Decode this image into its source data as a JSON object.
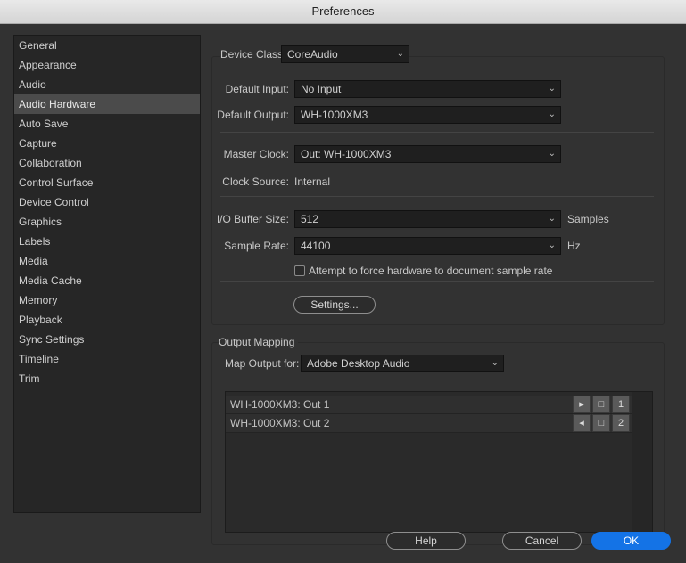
{
  "window": {
    "title": "Preferences"
  },
  "sidebar": {
    "items": [
      {
        "label": "General"
      },
      {
        "label": "Appearance"
      },
      {
        "label": "Audio"
      },
      {
        "label": "Audio Hardware"
      },
      {
        "label": "Auto Save"
      },
      {
        "label": "Capture"
      },
      {
        "label": "Collaboration"
      },
      {
        "label": "Control Surface"
      },
      {
        "label": "Device Control"
      },
      {
        "label": "Graphics"
      },
      {
        "label": "Labels"
      },
      {
        "label": "Media"
      },
      {
        "label": "Media Cache"
      },
      {
        "label": "Memory"
      },
      {
        "label": "Playback"
      },
      {
        "label": "Sync Settings"
      },
      {
        "label": "Timeline"
      },
      {
        "label": "Trim"
      }
    ],
    "selected": "Audio Hardware"
  },
  "hardware": {
    "device_class_label": "Device Class:",
    "device_class_value": "CoreAudio",
    "default_input_label": "Default Input:",
    "default_input_value": "No Input",
    "default_output_label": "Default Output:",
    "default_output_value": "WH-1000XM3",
    "master_clock_label": "Master Clock:",
    "master_clock_value": "Out: WH-1000XM3",
    "clock_source_label": "Clock Source:",
    "clock_source_value": "Internal",
    "buffer_label": "I/O Buffer Size:",
    "buffer_value": "512",
    "buffer_unit": "Samples",
    "sample_rate_label": "Sample Rate:",
    "sample_rate_value": "44100",
    "sample_rate_unit": "Hz",
    "force_rate_label": "Attempt to force hardware to document sample rate",
    "force_rate_checked": false,
    "settings_button": "Settings..."
  },
  "output_mapping": {
    "title": "Output Mapping",
    "map_for_label": "Map Output for:",
    "map_for_value": "Adobe Desktop Audio",
    "rows": [
      {
        "label": "WH-1000XM3: Out 1",
        "speaker_icon": "speaker-left-icon",
        "channel": "1"
      },
      {
        "label": "WH-1000XM3: Out 2",
        "speaker_icon": "speaker-right-icon",
        "channel": "2"
      }
    ]
  },
  "footer": {
    "help": "Help",
    "cancel": "Cancel",
    "ok": "OK"
  },
  "colors": {
    "accent": "#1473e6",
    "background": "#323232",
    "sidebar_selected": "#4b4b4b"
  }
}
